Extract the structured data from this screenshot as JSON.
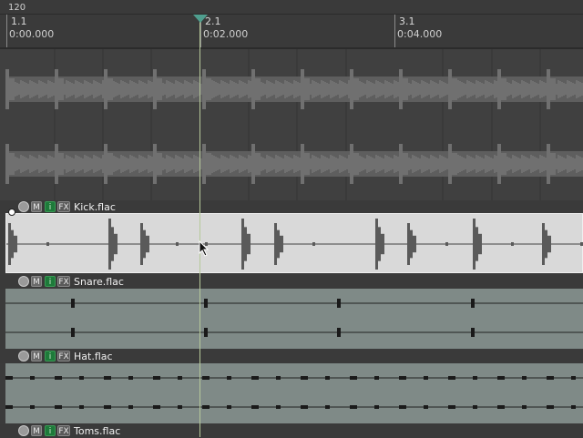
{
  "ruler": {
    "tempo": "120",
    "markers": [
      {
        "bar": "1.1",
        "time": "0:00.000"
      },
      {
        "bar": "2.1",
        "time": "0:02.000"
      },
      {
        "bar": "3.1",
        "time": "0:04.000"
      }
    ]
  },
  "tracks": [
    {
      "name": "Kick.flac",
      "selected": true
    },
    {
      "name": "Snare.flac",
      "selected": false
    },
    {
      "name": "Hat.flac",
      "selected": false
    },
    {
      "name": "Toms.flac",
      "selected": false
    }
  ],
  "track_buttons": {
    "mute": "M",
    "input": "i",
    "fx": "FX"
  },
  "colors": {
    "background": "#3b3b3b",
    "selected_track": "#d9d9d9",
    "track_body": "#7f8a87",
    "record_input": "#1e7a3a",
    "playhead": "#b6c99a",
    "playhead_marker": "#4f9e8e"
  },
  "icons": {
    "volume": "volume-knob-icon",
    "playhead": "playhead-triangle-icon",
    "cursor": "mouse-pointer-icon"
  }
}
